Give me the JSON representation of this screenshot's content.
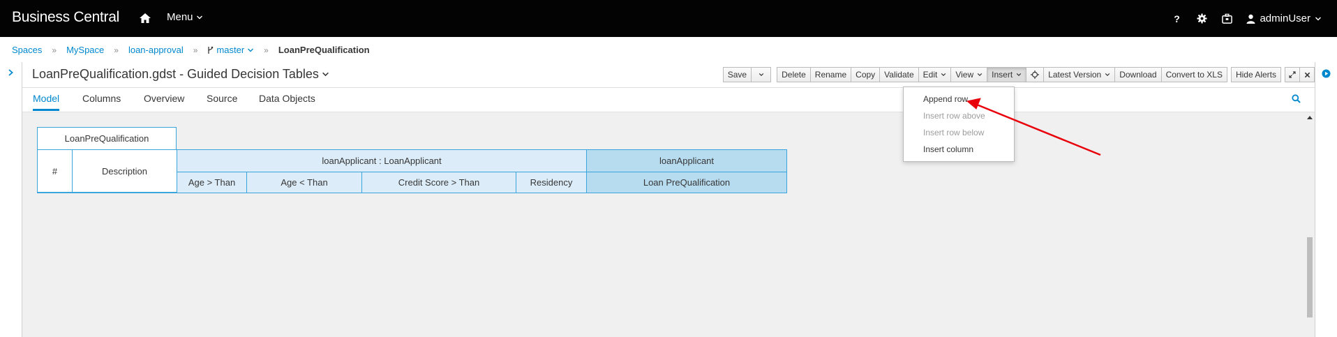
{
  "app": {
    "brand": "Business Central"
  },
  "topbar": {
    "menu_label": "Menu",
    "user_label": "adminUser",
    "help_label": "?"
  },
  "breadcrumb": {
    "items": [
      "Spaces",
      "MySpace",
      "loan-approval",
      "master"
    ],
    "current": "LoanPreQualification"
  },
  "editor": {
    "title": "LoanPreQualification.gdst - Guided Decision Tables"
  },
  "toolbar": {
    "save": "Save",
    "delete": "Delete",
    "rename": "Rename",
    "copy": "Copy",
    "validate": "Validate",
    "edit": "Edit",
    "view": "View",
    "insert": "Insert",
    "latest_version": "Latest Version",
    "download": "Download",
    "convert": "Convert to XLS",
    "hide_alerts": "Hide Alerts"
  },
  "tabs": [
    "Model",
    "Columns",
    "Overview",
    "Source",
    "Data Objects"
  ],
  "insert_menu": {
    "append_row": "Append row",
    "insert_row_above": "Insert row above",
    "insert_row_below": "Insert row below",
    "insert_column": "Insert column"
  },
  "decision_table": {
    "tab_label": "LoanPreQualification",
    "row_number_header": "#",
    "description_header": "Description",
    "condition_pattern": "loanApplicant : LoanApplicant",
    "condition_columns": [
      "Age > Than",
      "Age < Than",
      "Credit Score > Than",
      "Residency"
    ],
    "action_pattern": "loanApplicant",
    "action_columns": [
      "Loan PreQualification"
    ]
  },
  "colors": {
    "accent": "#0088ce",
    "table_border": "#39a5dc",
    "condition_fill": "#dcedf9",
    "action_fill": "#b7dbef",
    "annotation_arrow": "#e8000b"
  }
}
